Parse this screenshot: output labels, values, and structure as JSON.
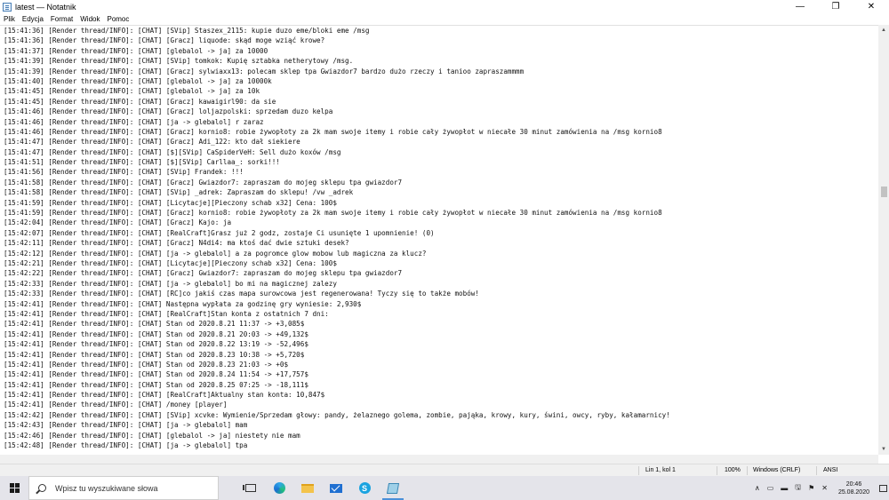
{
  "window": {
    "title": "latest — Notatnik",
    "minimize_glyph": "—",
    "maximize_glyph": "❐",
    "close_glyph": "✕"
  },
  "menu": [
    "Plik",
    "Edycja",
    "Format",
    "Widok",
    "Pomoc"
  ],
  "lines": [
    "[15:41:36] [Render thread/INFO]: [CHAT] [SVip] Staszex_2115: kupie duzo eme/bloki eme /msg",
    "[15:41:36] [Render thread/INFO]: [CHAT] [Gracz] liquode: skąd moge wziąć krowe?",
    "[15:41:37] [Render thread/INFO]: [CHAT] [glebalol -> ja] za 10000",
    "[15:41:39] [Render thread/INFO]: [CHAT] [SVip] tomkok: Kupię sztabka netherytowy /msg.",
    "[15:41:39] [Render thread/INFO]: [CHAT] [Gracz] sylwiaxx13: polecam sklep tpa Gwiazdor7 bardzo dużo rzeczy i tanioo zapraszammmm",
    "[15:41:40] [Render thread/INFO]: [CHAT] [glebalol -> ja] za 10000k",
    "[15:41:45] [Render thread/INFO]: [CHAT] [glebalol -> ja] za 10k",
    "[15:41:45] [Render thread/INFO]: [CHAT] [Gracz] kawaigirl90: da sie",
    "[15:41:46] [Render thread/INFO]: [CHAT] [Gracz] loljazpolski: sprzedam duzo kelpa",
    "[15:41:46] [Render thread/INFO]: [CHAT] [ja -> glebalol] r zaraz",
    "[15:41:46] [Render thread/INFO]: [CHAT] [Gracz] kornio8: robie żywopłoty za 2k mam swoje itemy i robie cały żywopłot w niecałe 30 minut zamówienia na /msg kornio8",
    "[15:41:47] [Render thread/INFO]: [CHAT] [Gracz] Adi_122: kto dał siekiere",
    "[15:41:47] [Render thread/INFO]: [CHAT] [$][SVip] CaSpiderVeH: Sell dużo koxów /msg",
    "[15:41:51] [Render thread/INFO]: [CHAT] [$][SVip] Carllaa_: sorki!!!",
    "[15:41:56] [Render thread/INFO]: [CHAT] [SVip] Frandek: !!!",
    "[15:41:58] [Render thread/INFO]: [CHAT] [Gracz] Gwiazdor7: zapraszam do mojeg sklepu tpa gwiazdor7",
    "[15:41:58] [Render thread/INFO]: [CHAT] [SVip] _adrek: Zapraszam do sklepu! /vw _adrek",
    "[15:41:59] [Render thread/INFO]: [CHAT] [Licytacje][Pieczony schab x32] Cena: 100$",
    "[15:41:59] [Render thread/INFO]: [CHAT] [Gracz] kornio8: robie żywopłoty za 2k mam swoje itemy i robie cały żywopłot w niecałe 30 minut zamówienia na /msg kornio8",
    "[15:42:04] [Render thread/INFO]: [CHAT] [Gracz] Kajo: ja",
    "[15:42:07] [Render thread/INFO]: [CHAT] [RealCraft]Grasz już 2 godz, zostaje Ci usunięte 1 upomnienie! (0)",
    "[15:42:11] [Render thread/INFO]: [CHAT] [Gracz] N4di4: ma ktoś dać dwie sztuki desek?",
    "[15:42:12] [Render thread/INFO]: [CHAT] [ja -> glebalol] a za pogromce glow mobow lub magiczna za klucz?",
    "[15:42:21] [Render thread/INFO]: [CHAT] [Licytacje][Pieczony schab x32] Cena: 100$",
    "[15:42:22] [Render thread/INFO]: [CHAT] [Gracz] Gwiazdor7: zapraszam do mojeg sklepu tpa gwiazdor7",
    "[15:42:33] [Render thread/INFO]: [CHAT] [ja -> glebalol] bo mi na magicznej zalezy",
    "[15:42:33] [Render thread/INFO]: [CHAT] [RC]co jakiś czas mapa surowcowa jest regenerowana! Tyczy się to także mobów!",
    "[15:42:41] [Render thread/INFO]: [CHAT] Następna wypłata za godzinę gry wyniesie: 2,930$",
    "[15:42:41] [Render thread/INFO]: [CHAT] [RealCraft]Stan konta z ostatnich 7 dni:",
    "[15:42:41] [Render thread/INFO]: [CHAT] Stan od 2020.8.21 11:37 -> +3,085$",
    "[15:42:41] [Render thread/INFO]: [CHAT] Stan od 2020.8.21 20:03 -> +49,132$",
    "[15:42:41] [Render thread/INFO]: [CHAT] Stan od 2020.8.22 13:19 -> -52,496$",
    "[15:42:41] [Render thread/INFO]: [CHAT] Stan od 2020.8.23 10:38 -> +5,720$",
    "[15:42:41] [Render thread/INFO]: [CHAT] Stan od 2020.8.23 21:03 -> +0$",
    "[15:42:41] [Render thread/INFO]: [CHAT] Stan od 2020.8.24 11:54 -> +17,757$",
    "[15:42:41] [Render thread/INFO]: [CHAT] Stan od 2020.8.25 07:25 -> -18,111$",
    "[15:42:41] [Render thread/INFO]: [CHAT] [RealCraft]Aktualny stan konta: 10,847$",
    "[15:42:41] [Render thread/INFO]: [CHAT] /money [player]",
    "[15:42:42] [Render thread/INFO]: [CHAT] [SVip] xcvke: Wymienie/Sprzedam głowy: pandy, żelaznego golema, zombie, pająka, krowy, kury, świni, owcy, ryby, kałamarnicy!",
    "[15:42:43] [Render thread/INFO]: [CHAT] [ja -> glebalol] mam",
    "[15:42:46] [Render thread/INFO]: [CHAT] [glebalol -> ja] niestety nie mam",
    "[15:42:48] [Render thread/INFO]: [CHAT] [ja -> glebalol] tpa"
  ],
  "status": {
    "position": "Lin 1, kol 1",
    "zoom": "100%",
    "line_ending": "Windows (CRLF)",
    "encoding": "ANSI"
  },
  "taskbar": {
    "search_placeholder": "Wpisz tu wyszukiwane słowa",
    "skype_letter": "S",
    "time": "20:46",
    "date": "25.08.2020",
    "tray_chevron": "∧",
    "tray_icons": [
      "▭",
      "▬",
      "🖫",
      "⚑",
      "✕"
    ]
  }
}
